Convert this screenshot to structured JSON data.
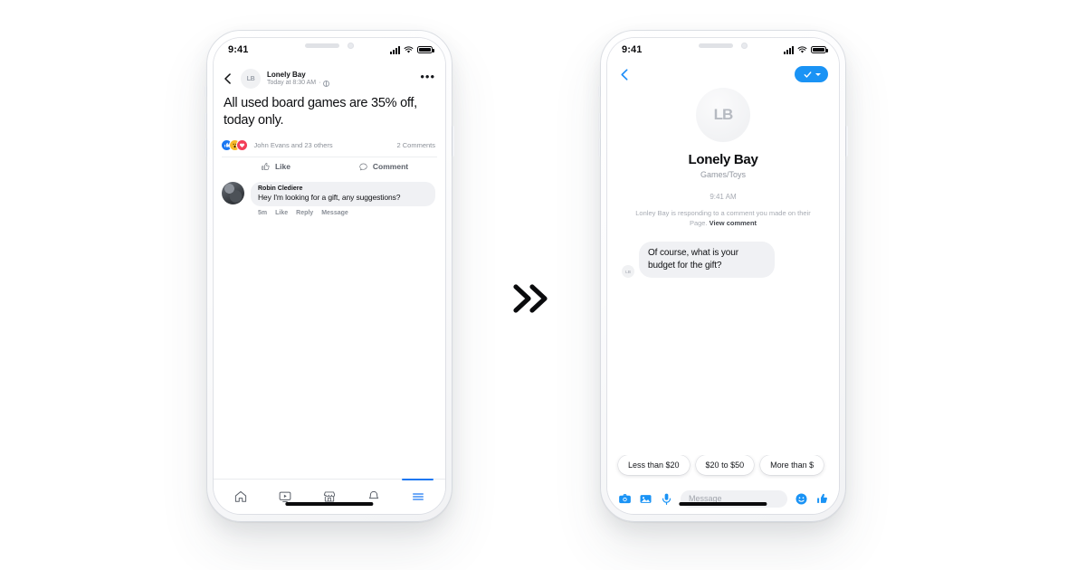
{
  "arrow": {
    "name": "double-chevron-right"
  },
  "phone_left": {
    "status_bar": {
      "time": "9:41",
      "signal_icon": "cellular-bars-icon",
      "wifi_icon": "wifi-icon",
      "battery_icon": "battery-full-icon"
    },
    "post": {
      "back_icon": "chevron-left-icon",
      "avatar_initials": "LB",
      "page_name": "Lonely Bay",
      "timestamp": "Today at 8:30 AM",
      "privacy_icon": "globe-icon",
      "more_icon": "ellipsis-icon",
      "more_label": "•••",
      "text": "All used board games are 35% off, today only.",
      "reactions": [
        {
          "name": "like-reaction",
          "color": "#1a77f2",
          "glyph": "👍"
        },
        {
          "name": "wow-reaction",
          "color": "#f7b928",
          "glyph": "😮"
        },
        {
          "name": "love-reaction",
          "color": "#f33e58",
          "glyph": "❤"
        }
      ],
      "reaction_names": "John Evans and 23 others",
      "comment_count": "2 Comments",
      "actions": [
        {
          "name": "like-button",
          "label": "Like",
          "icon": "thumbs-up-icon"
        },
        {
          "name": "comment-button",
          "label": "Comment",
          "icon": "speech-bubble-icon"
        }
      ],
      "comment": {
        "author": "Robin Clediere",
        "text": "Hey I'm looking for a gift, any suggestions?",
        "meta": [
          "5m",
          "Like",
          "Reply",
          "Message"
        ]
      }
    },
    "tabbar": [
      {
        "name": "tab-home",
        "icon": "home-icon",
        "active": false
      },
      {
        "name": "tab-watch",
        "icon": "video-icon",
        "active": false
      },
      {
        "name": "tab-marketplace",
        "icon": "storefront-icon",
        "active": false
      },
      {
        "name": "tab-notifications",
        "icon": "bell-icon",
        "active": false
      },
      {
        "name": "tab-menu",
        "icon": "hamburger-menu-icon",
        "active": true
      }
    ]
  },
  "phone_right": {
    "status_bar": {
      "time": "9:41",
      "signal_icon": "cellular-bars-icon",
      "wifi_icon": "wifi-icon",
      "battery_icon": "battery-full-icon"
    },
    "header": {
      "back_icon": "chevron-left-icon",
      "verified_badge": {
        "name": "verified-check-badge",
        "icon": "check-icon",
        "caret_icon": "caret-down-icon",
        "color": "#1a93f5"
      }
    },
    "profile": {
      "avatar_initials": "LB",
      "name": "Lonely Bay",
      "category": "Games/Toys"
    },
    "conversation": {
      "time": "9:41 AM",
      "notice_prefix": "Lonley Bay is responding to a comment you made on their Page.",
      "notice_link": "View comment",
      "messages": [
        {
          "name": "incoming-message",
          "avatar_initials": "LB",
          "text": "Of course, what is your budget for the gift?"
        }
      ]
    },
    "quick_replies": [
      {
        "name": "chip-less-than-20",
        "label": "Less than $20"
      },
      {
        "name": "chip-20-to-50",
        "label": "$20 to $50"
      },
      {
        "name": "chip-more-than",
        "label": "More than $"
      }
    ],
    "composer": {
      "camera_icon": "camera-icon",
      "gallery_icon": "photo-icon",
      "mic_icon": "microphone-icon",
      "placeholder": "Message",
      "emoji_icon": "smiley-icon",
      "thumb_icon": "thumbs-up-icon"
    }
  }
}
